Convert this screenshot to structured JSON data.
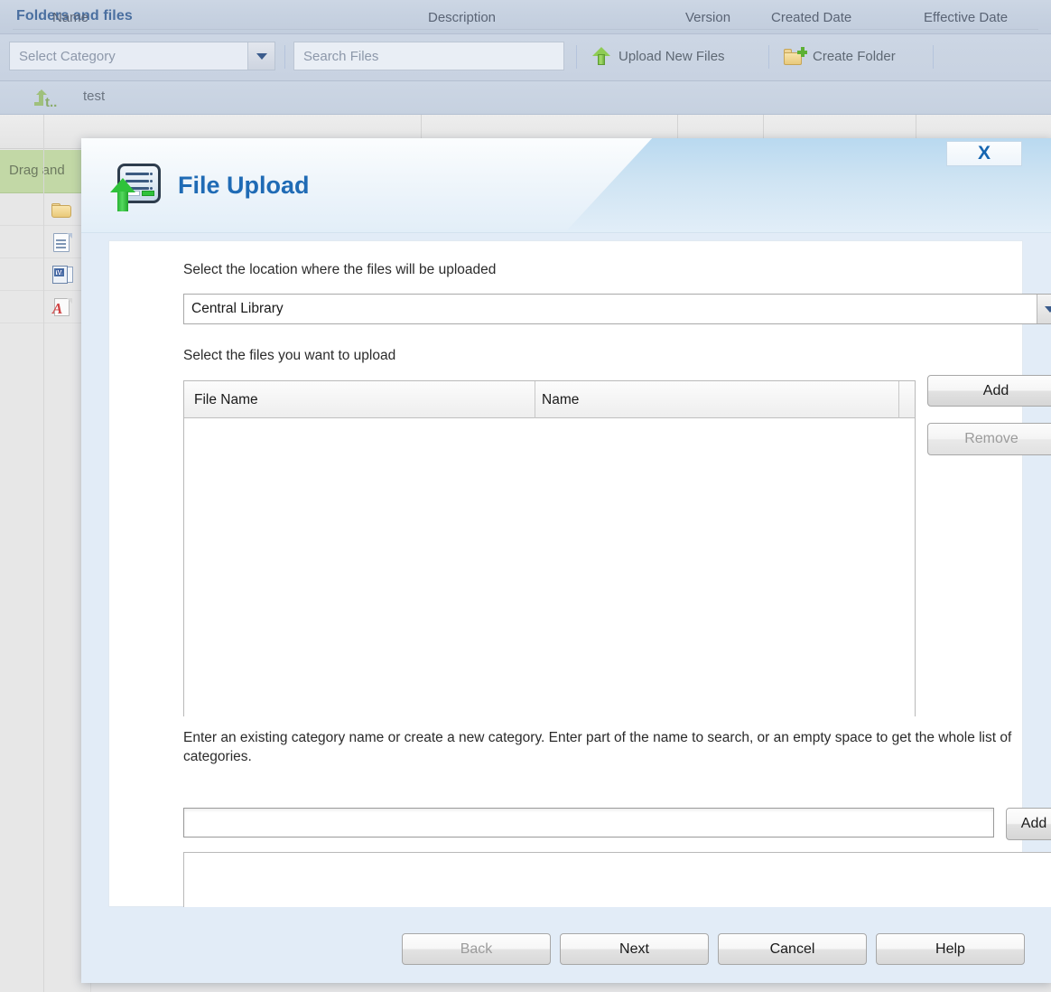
{
  "background": {
    "panel_title": "Folders and files",
    "toolbar": {
      "category_select_placeholder": "Select Category",
      "search_placeholder": "Search Files",
      "upload_button": "Upload New Files",
      "create_folder_button": "Create Folder"
    },
    "breadcrumb": {
      "up_label": "t..",
      "current_folder": "test"
    },
    "grid_headers": [
      "Name",
      "Description",
      "Version",
      "Created Date",
      "Effective Date"
    ],
    "drag_strip_text": "Drag and",
    "row_icons": [
      "folder-icon",
      "document-icon",
      "word-document-icon",
      "pdf-document-icon"
    ]
  },
  "dialog": {
    "title": "File Upload",
    "title_icon": "file-upload-icon",
    "close_label": "X",
    "location_label": "Select the location where the files will be uploaded",
    "location_value": "Central Library",
    "files_label": "Select the files you want to upload",
    "files_table": {
      "columns": [
        "File Name",
        "Name"
      ],
      "rows": []
    },
    "add_file_button": "Add",
    "remove_file_button": "Remove",
    "category_hint": "Enter an existing category name or create a new category. Enter part of the name to search, or an empty space to get the whole list of categories.",
    "category_input_value": "",
    "add_category_button": "Add",
    "footer": {
      "back": "Back",
      "next": "Next",
      "cancel": "Cancel",
      "help": "Help"
    }
  },
  "colors": {
    "dialog_title": "#1f6bb5",
    "panel_title": "#4a6fa5",
    "dialog_bg": "#e2ecf7",
    "drag_strip": "#c2d8a6"
  }
}
